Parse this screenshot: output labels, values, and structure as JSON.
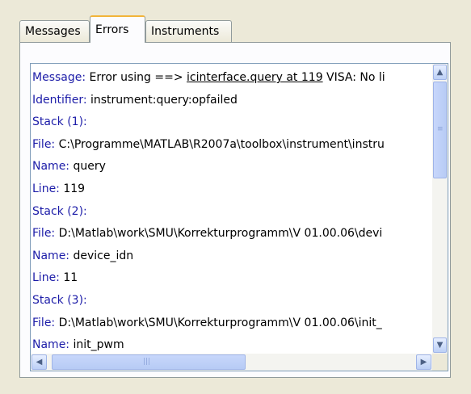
{
  "tabs": [
    "Messages",
    "Errors",
    "Instruments"
  ],
  "lines": [
    {
      "key": "Message:",
      "text": "Error using ==> ",
      "link": "icinterface.query at 119",
      "rest": " VISA: No li"
    },
    {
      "key": "Identifier:",
      "text": "instrument:query:opfailed"
    },
    {
      "key": "Stack (1):",
      "text": ""
    },
    {
      "key": "File:",
      "text": "C:\\Programme\\MATLAB\\R2007a\\toolbox\\instrument\\instru"
    },
    {
      "key": "Name:",
      "text": "query"
    },
    {
      "key": "Line:",
      "text": "119"
    },
    {
      "key": "Stack (2):",
      "text": ""
    },
    {
      "key": "File:",
      "text": "D:\\Matlab\\work\\SMU\\Korrekturprogramm\\V 01.00.06\\devi"
    },
    {
      "key": "Name:",
      "text": "device_idn"
    },
    {
      "key": "Line:",
      "text": "11"
    },
    {
      "key": "Stack (3):",
      "text": ""
    },
    {
      "key": "File:",
      "text": "D:\\Matlab\\work\\SMU\\Korrekturprogramm\\V 01.00.06\\init_"
    },
    {
      "key": "Name:",
      "text": "init_pwm"
    }
  ]
}
